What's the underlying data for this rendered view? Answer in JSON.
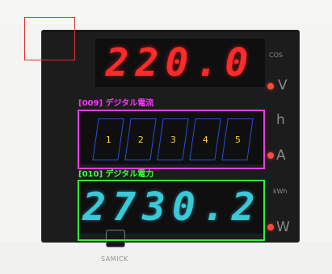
{
  "meter": {
    "voltage_display": "220.0",
    "current_display": "",
    "power_display": "2730.2"
  },
  "labels": {
    "current": "[009] デジタル電流",
    "power": "[010] デジタル電力"
  },
  "digit_slots": [
    {
      "number": "1"
    },
    {
      "number": "2"
    },
    {
      "number": "3"
    },
    {
      "number": "4"
    },
    {
      "number": "5"
    }
  ],
  "units": {
    "top_small": "COS",
    "v": "V",
    "h": "h",
    "a": "A",
    "kwh": "kWh",
    "w": "W"
  },
  "brand": "SAMICK",
  "colors": {
    "panel": "#1c1c1c",
    "red_segment": "#ff2a2a",
    "teal_segment": "#39c9d9",
    "magenta_frame": "#e63ee6",
    "green_frame": "#31f03a",
    "red_frame": "#e03030",
    "digit_box_border": "#2c4ed8",
    "digit_number": "#ffd040"
  }
}
